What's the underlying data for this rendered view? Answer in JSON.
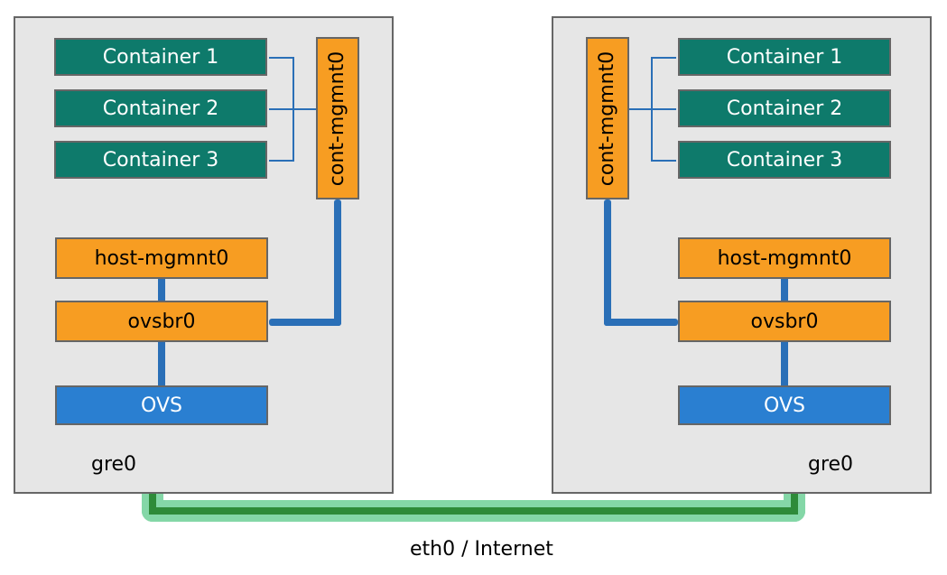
{
  "hosts": {
    "left": {
      "containers": [
        "Container 1",
        "Container 2",
        "Container 3"
      ],
      "cont_mgmt": "cont-mgmnt0",
      "host_mgmt": "host-mgmnt0",
      "ovsbr": "ovsbr0",
      "ovs": "OVS",
      "gre": "gre0"
    },
    "right": {
      "containers": [
        "Container 1",
        "Container 2",
        "Container 3"
      ],
      "cont_mgmt": "cont-mgmnt0",
      "host_mgmt": "host-mgmnt0",
      "ovsbr": "ovsbr0",
      "ovs": "OVS",
      "gre": "gre0"
    }
  },
  "bottom_label": "eth0 / Internet",
  "colors": {
    "host_bg": "#e6e6e6",
    "container": "#0e7a6b",
    "orange": "#f79d22",
    "ovs": "#2a7fd1",
    "blue_line": "#2a6fb7",
    "gre_band": "#84d7a7",
    "gre_dark": "#2e8b39"
  }
}
